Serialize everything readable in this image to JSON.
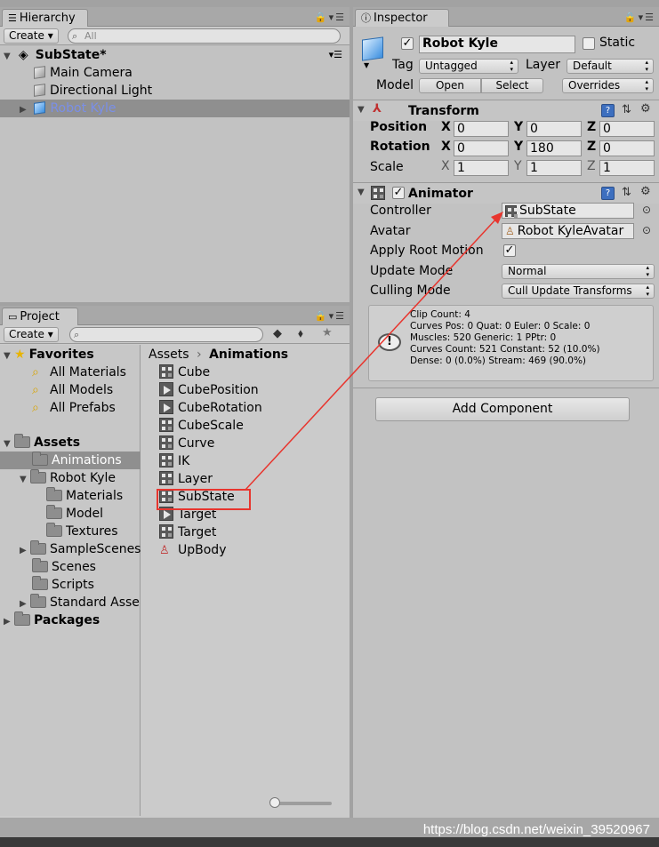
{
  "hierarchy": {
    "tab_label": "Hierarchy",
    "create_label": "Create ▾",
    "search_placeholder": "All",
    "scene_name": "SubState*",
    "items": [
      {
        "label": "Main Camera"
      },
      {
        "label": "Directional Light"
      },
      {
        "label": "Robot Kyle"
      }
    ]
  },
  "project": {
    "tab_label": "Project",
    "create_label": "Create ▾",
    "favorites": {
      "label": "Favorites",
      "items": [
        "All Materials",
        "All Models",
        "All Prefabs"
      ]
    },
    "tree": [
      {
        "label": "Assets",
        "bold": true
      },
      {
        "label": "Animations"
      },
      {
        "label": "Robot Kyle"
      },
      {
        "label": "Materials"
      },
      {
        "label": "Model"
      },
      {
        "label": "Textures"
      },
      {
        "label": "SampleScenes"
      },
      {
        "label": "Scenes"
      },
      {
        "label": "Scripts"
      },
      {
        "label": "Standard Asse"
      },
      {
        "label": "Packages",
        "bold": true
      }
    ],
    "breadcrumb": {
      "root": "Assets",
      "separator": "›",
      "current": "Animations"
    },
    "assets": [
      {
        "label": "Cube",
        "icon": "controller-icon"
      },
      {
        "label": "CubePosition",
        "icon": "clip-icon"
      },
      {
        "label": "CubeRotation",
        "icon": "clip-icon"
      },
      {
        "label": "CubeScale",
        "icon": "controller-icon"
      },
      {
        "label": "Curve",
        "icon": "controller-icon"
      },
      {
        "label": "IK",
        "icon": "controller-icon"
      },
      {
        "label": "Layer",
        "icon": "controller-icon"
      },
      {
        "label": "SubState",
        "icon": "controller-icon"
      },
      {
        "label": "Target",
        "icon": "clip-icon"
      },
      {
        "label": "Target",
        "icon": "controller-icon"
      },
      {
        "label": "UpBody",
        "icon": "avatar-mask-icon"
      }
    ]
  },
  "inspector": {
    "tab_label": "Inspector",
    "object_name": "Robot Kyle",
    "static_label": "Static",
    "tag_label": "Tag",
    "tag_value": "Untagged",
    "layer_label": "Layer",
    "layer_value": "Default",
    "model_label": "Model",
    "open_label": "Open",
    "select_label": "Select",
    "overrides_label": "Overrides",
    "transform": {
      "title": "Transform",
      "position_label": "Position",
      "rotation_label": "Rotation",
      "scale_label": "Scale",
      "x": "X",
      "y": "Y",
      "z": "Z",
      "position": [
        "0",
        "0",
        "0"
      ],
      "rotation": [
        "0",
        "180",
        "0"
      ],
      "scale": [
        "1",
        "1",
        "1"
      ]
    },
    "animator": {
      "title": "Animator",
      "controller_label": "Controller",
      "controller_value": "SubState",
      "avatar_label": "Avatar",
      "avatar_value": "Robot KyleAvatar",
      "root_motion_label": "Apply Root Motion",
      "update_mode_label": "Update Mode",
      "update_mode_value": "Normal",
      "culling_mode_label": "Culling Mode",
      "culling_mode_value": "Cull Update Transforms",
      "info": [
        "Clip Count: 4",
        "Curves Pos: 0 Quat: 0 Euler: 0 Scale: 0",
        "Muscles: 520 Generic: 1 PPtr: 0",
        "Curves Count: 521 Constant: 52 (10.0%)",
        "Dense: 0 (0.0%) Stream: 469 (90.0%)"
      ]
    },
    "add_component_label": "Add Component"
  },
  "watermark": "https://blog.csdn.net/weixin_39520967",
  "colors": {
    "selection": "#8f8f8f",
    "selected_text": "#7a8fe8",
    "highlight_box": "#e8352e",
    "arrow": "#e8352e"
  }
}
